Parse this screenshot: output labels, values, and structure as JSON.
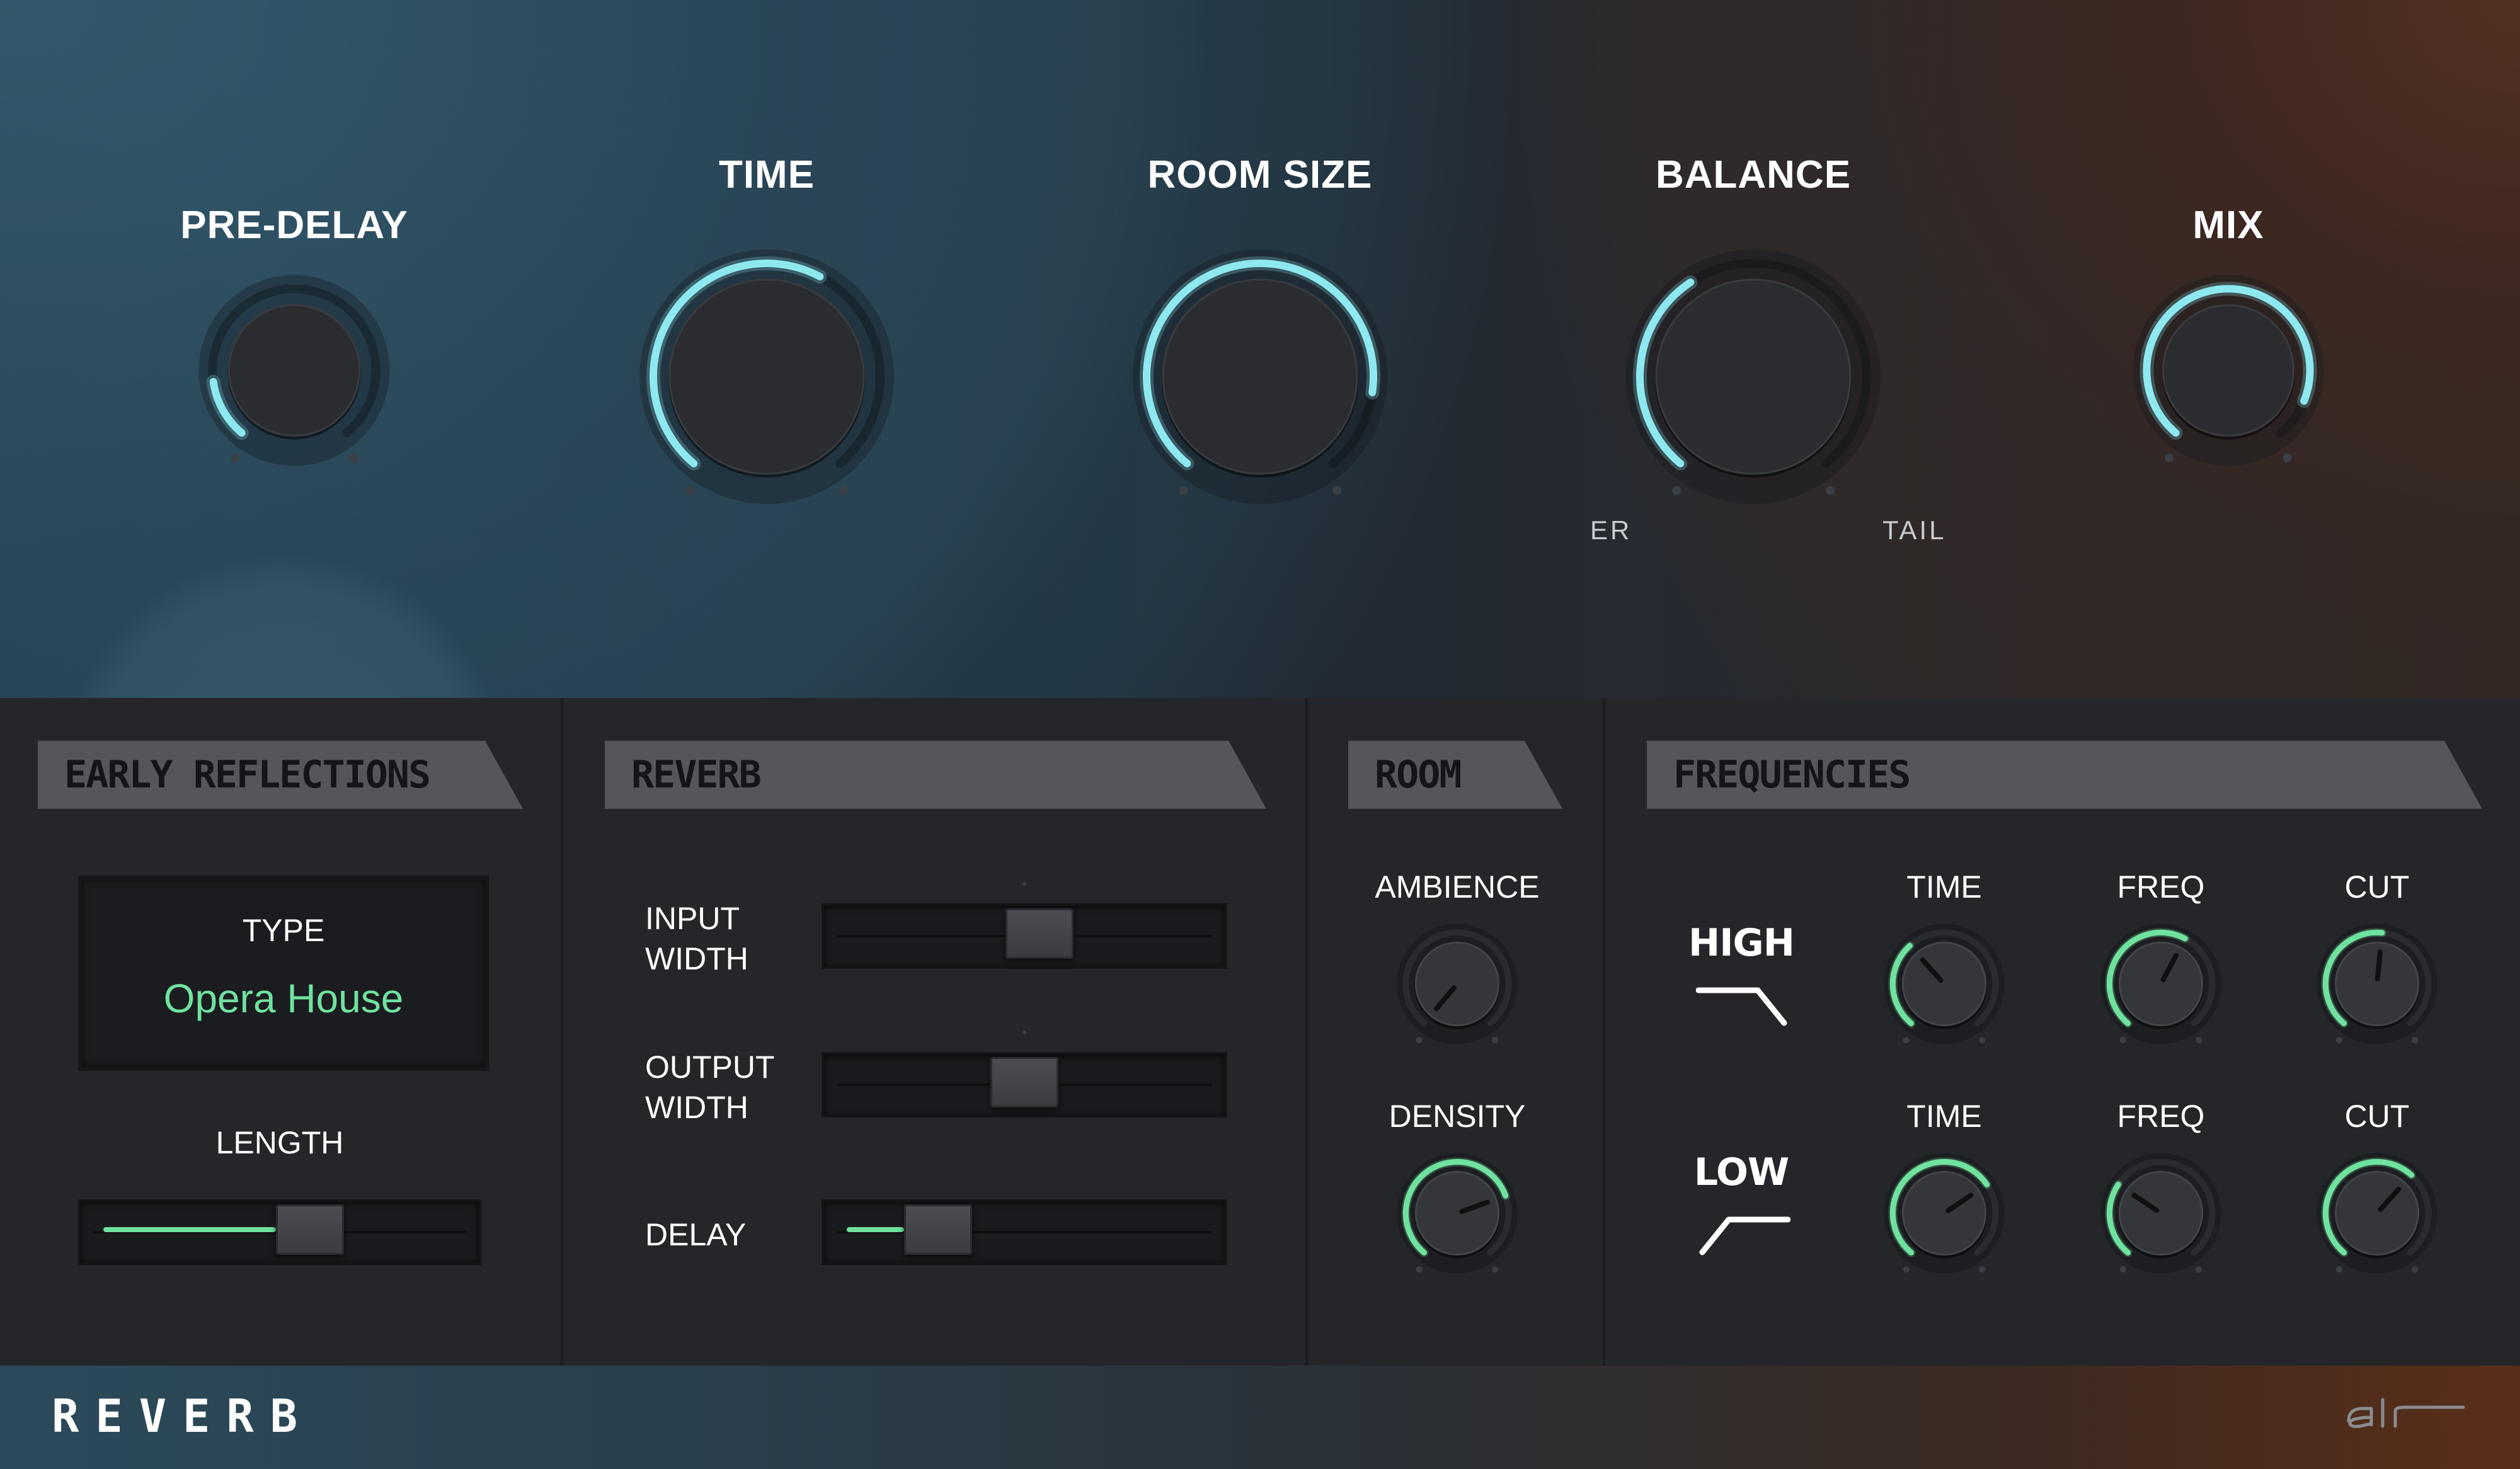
{
  "hero": {
    "knobs": [
      {
        "id": "pre-delay",
        "label": "PRE-DELAY",
        "value": 0.15
      },
      {
        "id": "time",
        "label": "TIME",
        "value": 0.6
      },
      {
        "id": "room-size",
        "label": "ROOM SIZE",
        "value": 0.85
      },
      {
        "id": "balance",
        "label": "BALANCE",
        "value": 0.38
      },
      {
        "id": "mix",
        "label": "MIX",
        "value": 0.9
      }
    ],
    "balance_left_label": "ER",
    "balance_right_label": "TAIL"
  },
  "early_reflections": {
    "header": "EARLY REFLECTIONS",
    "type_label": "TYPE",
    "type_value": "Opera House",
    "length_label": "LENGTH",
    "length_value": 0.6
  },
  "reverb": {
    "header": "REVERB",
    "input_width": {
      "line1": "INPUT",
      "line2": "WIDTH",
      "value": 0.55
    },
    "output_width": {
      "line1": "OUTPUT",
      "line2": "WIDTH",
      "value": 0.5
    },
    "delay": {
      "label": "DELAY",
      "value": 0.22
    }
  },
  "room": {
    "header": "ROOM",
    "ambience": {
      "label": "AMBIENCE",
      "value": 0.0
    },
    "density": {
      "label": "DENSITY",
      "value": 0.75
    }
  },
  "frequencies": {
    "header": "FREQUENCIES",
    "high": {
      "label": "HIGH",
      "time": {
        "label": "TIME",
        "value": 0.35
      },
      "freq": {
        "label": "FREQ",
        "value": 0.6
      },
      "cut": {
        "label": "CUT",
        "value": 0.52
      }
    },
    "low": {
      "label": "LOW",
      "time": {
        "label": "TIME",
        "value": 0.7
      },
      "freq": {
        "label": "FREQ",
        "value": 0.3
      },
      "cut": {
        "label": "CUT",
        "value": 0.65
      }
    }
  },
  "footer": {
    "title": "REVERB",
    "brand": "air"
  },
  "colors": {
    "accent_blue": "#8ee8f0",
    "accent_green": "#6fe2a0",
    "panel_bg": "#25262a",
    "header_tab": "#54565c"
  }
}
